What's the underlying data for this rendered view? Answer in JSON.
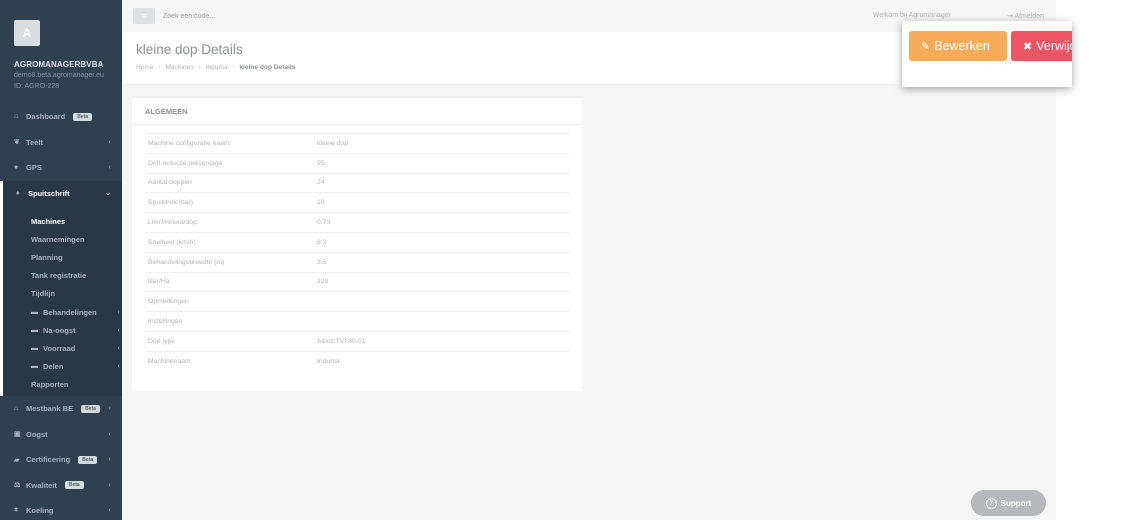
{
  "profile": {
    "avatar_letter": "A",
    "company": "AGROMANAGERBVBA",
    "email": "demo8.beta.agromanager.eu",
    "id": "ID: AGRO-228"
  },
  "sidebar": {
    "items": [
      {
        "label": "Dashboard",
        "icon": "home-icon",
        "badge": "Beta"
      },
      {
        "label": "Teelt",
        "icon": "leaf-icon"
      },
      {
        "label": "GPS",
        "icon": "map-marker-icon"
      },
      {
        "label": "Spuitschrift",
        "icon": "tint-icon",
        "active": true
      },
      {
        "label": "Mestbank BE",
        "icon": "bank-icon",
        "badge": "Beta"
      },
      {
        "label": "Oogst",
        "icon": "truck-icon"
      },
      {
        "label": "Certificering",
        "icon": "certificate-icon",
        "badge": "Beta"
      },
      {
        "label": "Kwaliteit",
        "icon": "balance-icon",
        "badge": "Beta"
      },
      {
        "label": "Koeling",
        "icon": "thermometer-icon"
      }
    ],
    "sub_items": [
      {
        "label": "Machines",
        "current": true
      },
      {
        "label": "Waarnemingen"
      },
      {
        "label": "Planning"
      },
      {
        "label": "Tank registratie"
      },
      {
        "label": "Tijdlijn"
      },
      {
        "label": "Behandelingen",
        "icon": "folder-icon"
      },
      {
        "label": "Na-oogst",
        "icon": "folder-icon"
      },
      {
        "label": "Voorraad",
        "icon": "folder-icon"
      },
      {
        "label": "Delen",
        "icon": "folder-icon"
      },
      {
        "label": "Rapporten"
      }
    ]
  },
  "topbar": {
    "search_placeholder": "Zoek een code...",
    "welcome": "Welkom bij Agromanager",
    "logout": "Afmelden"
  },
  "header": {
    "title": "kleine dop Details",
    "breadcrumb": [
      "Home",
      "Machines",
      "Induma",
      "kleine dop Details"
    ]
  },
  "panel": {
    "title": "ALGEMEEN",
    "rows": [
      {
        "label": "Machine configuratie naam",
        "value": "kleine dop"
      },
      {
        "label": "Drift reductie percentage",
        "value": "95"
      },
      {
        "label": "Aantal doppen",
        "value": "24"
      },
      {
        "label": "Spuitdruk (bar)",
        "value": "10"
      },
      {
        "label": "Liter/minuut/dop",
        "value": "0.73"
      },
      {
        "label": "Snelheid (km/h)",
        "value": "8.3"
      },
      {
        "label": "Behandelingsbreedte (m)",
        "value": "3.5"
      },
      {
        "label": "liter/Ha",
        "value": "228"
      },
      {
        "label": "Opmerkingen",
        "value": ""
      },
      {
        "label": "Instellingen",
        "value": ""
      },
      {
        "label": "Dop type",
        "value": "Albuz TVI 80-01"
      },
      {
        "label": "Machinenaam",
        "value": "Induma"
      }
    ]
  },
  "actions": {
    "edit": "Bewerken",
    "delete": "Verwijderen"
  },
  "support": "Support",
  "colors": {
    "sidebar": "#2f4050",
    "edit": "#f8ac59",
    "delete": "#ed5565"
  }
}
